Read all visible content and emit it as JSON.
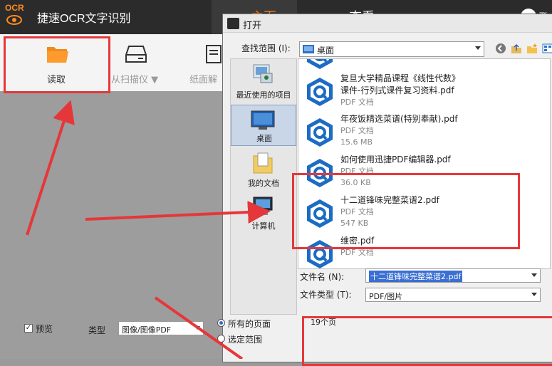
{
  "app": {
    "logo_text": "OCR",
    "title": "捷速OCR文字识别",
    "tabs": [
      "主页",
      "查看"
    ],
    "user_text": "登"
  },
  "toolbar": {
    "read_label": "读取",
    "scan_label": "从扫描仪 ▼",
    "face_label": "纸面解"
  },
  "dialog": {
    "title": "打开",
    "lookin_label": "查找范围 (I):",
    "lookin_value": "桌面",
    "places": [
      "最近使用的项目",
      "桌面",
      "我的文档",
      "计算机"
    ],
    "files": [
      {
        "name": "",
        "line2": "",
        "meta1": "PDF 文档",
        "meta2": ""
      },
      {
        "name": "复旦大学精品课程《线性代数》",
        "line2": "课件-行列式课件复习资料.pdf",
        "meta1": "PDF 文档",
        "meta2": ""
      },
      {
        "name": "年夜饭精选菜谱(特别奉献).pdf",
        "line2": "",
        "meta1": "PDF 文档",
        "meta2": "15.6 MB"
      },
      {
        "name": "如何使用迅捷PDF编辑器.pdf",
        "line2": "",
        "meta1": "PDF 文档",
        "meta2": "36.0 KB"
      },
      {
        "name": "十二道锋味完整菜谱2.pdf",
        "line2": "",
        "meta1": "PDF 文档",
        "meta2": "547 KB"
      },
      {
        "name": "维密.pdf",
        "line2": "",
        "meta1": "PDF 文档",
        "meta2": ""
      }
    ],
    "filename_label": "文件名 (N):",
    "filename_value": "十二道锋味完整菜谱2.pdf",
    "filetype_label": "文件类型 (T):",
    "filetype_value": "PDF/图片",
    "preview_label": "预览",
    "preview_check": "✓",
    "type_label": "类型",
    "type_value": "图像/图像PDF",
    "radio_all": "所有的页面",
    "radio_range": "选定范围",
    "page_count": "19个页"
  },
  "colors": {
    "accent": "#ff7b1c",
    "highlight": "#e5373a",
    "titlebar": "#2b2b2b"
  }
}
